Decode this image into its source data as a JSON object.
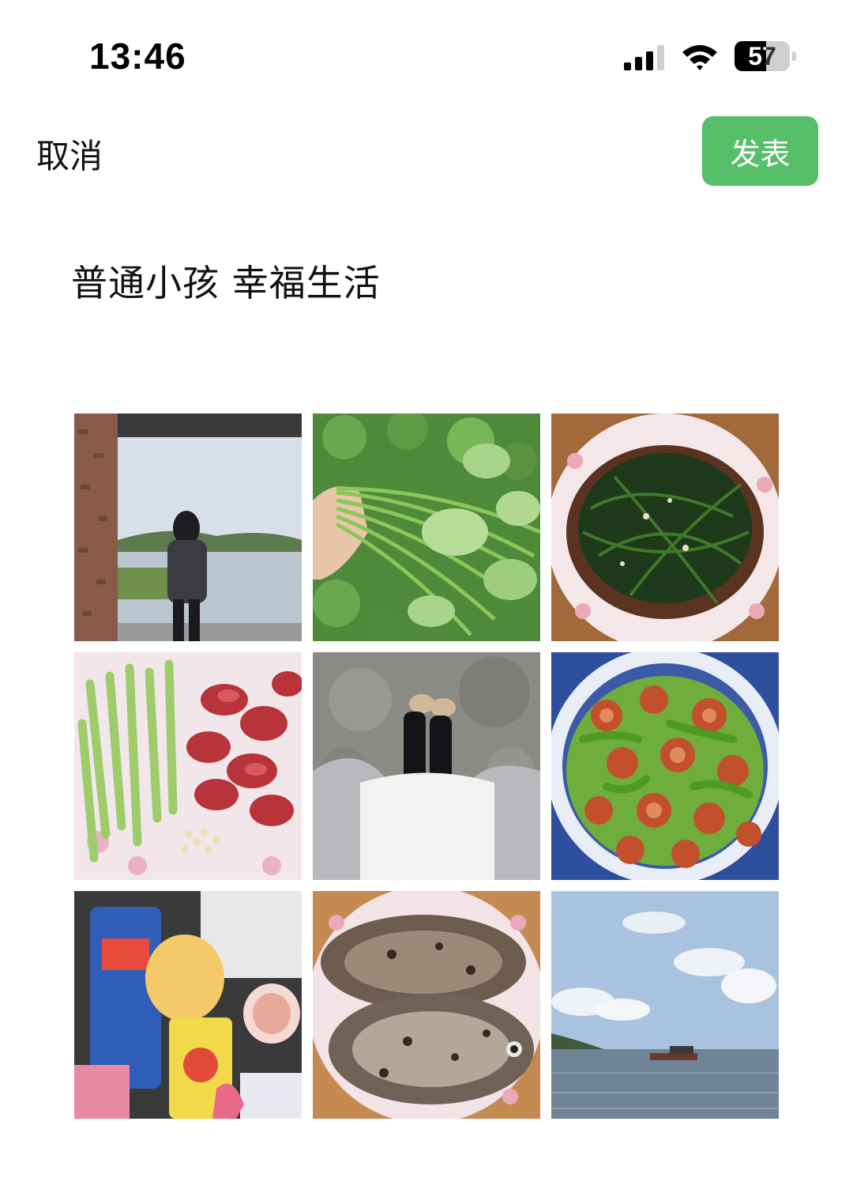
{
  "status_bar": {
    "time": "13:46",
    "battery_level": "57",
    "battery_fill_fraction": 0.57,
    "icons": [
      "cellular-signal-icon",
      "wifi-icon",
      "battery-icon"
    ]
  },
  "nav": {
    "cancel_label": "取消",
    "publish_label": "发表"
  },
  "post": {
    "text": "普通小孩 幸福生活"
  },
  "photos": [
    "girl-at-window-lake-photo",
    "sweet-potato-greens-in-hand-photo",
    "stir-fried-greens-plate-photo",
    "sliced-peppers-and-sausage-photo",
    "legs-on-concrete-photo",
    "pepper-sausage-stirfry-photo",
    "snacks-in-bag-photo",
    "fried-fish-plate-photo",
    "river-boat-sky-photo"
  ],
  "colors": {
    "publish_button": "#57be6a",
    "background": "#ffffff",
    "text": "#111111"
  }
}
